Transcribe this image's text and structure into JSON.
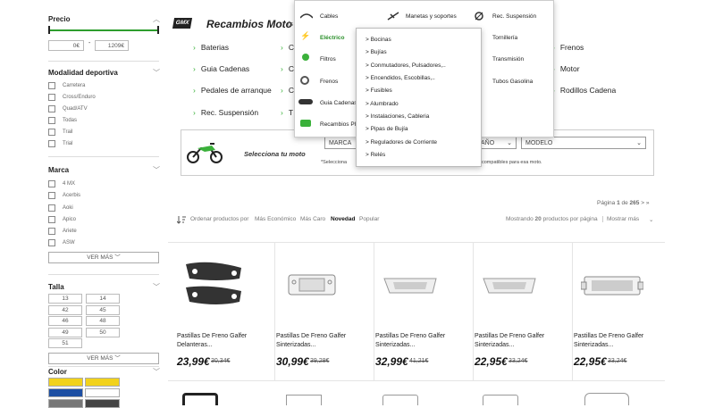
{
  "sidebar": {
    "price": {
      "title": "Precio",
      "min": "0€",
      "sep": "-",
      "max": "1209€"
    },
    "modalidad": {
      "title": "Modalidad deportiva",
      "items": [
        "Carretera",
        "Cross/Enduro",
        "Quad/ATV",
        "Todas",
        "Trail",
        "Trial"
      ]
    },
    "marca": {
      "title": "Marca",
      "items": [
        "4 MX",
        "Acerbis",
        "Aoki",
        "Apico",
        "Ariete",
        "ASW"
      ],
      "ver_mas": "VER MÁS"
    },
    "talla": {
      "title": "Talla",
      "sizes": [
        "13",
        "14",
        "42",
        "45",
        "46",
        "48",
        "49",
        "50",
        "51"
      ],
      "ver_mas": "VER MÁS"
    },
    "color": {
      "title": "Color",
      "swatches": [
        "#f2d21b",
        "#f2d21b",
        "#1d4fa3",
        "#ffffff",
        "#777777",
        "#444444"
      ]
    }
  },
  "brand_logo": "GMX",
  "header": {
    "title": "Recambios Moto",
    "subtitle": "(s"
  },
  "categories": {
    "col1": [
      "Baterias",
      "Guia Cadenas",
      "Pedales de arranque",
      "Rec. Suspensión"
    ],
    "col2": [
      "C",
      "C",
      "C",
      "T"
    ],
    "col4": [
      "Frenos",
      "Motor",
      "Rodillos Cadena"
    ]
  },
  "mega_menu": {
    "col1": [
      "Cables",
      "Eléctrico",
      "Filtros",
      "Frenos",
      "Guia Cadenas",
      "Recambios Pl"
    ],
    "col2": [
      "Manetas y soportes"
    ],
    "col3": [
      "Rec. Suspensión",
      "Tornillería",
      "Transmisión",
      "Tubos Gasolina"
    ]
  },
  "submenu": [
    "> Bocinas",
    "> Bujías",
    "> Conmutadores, Pulsadores,..",
    "> Encendidos, Escobillas,..",
    "> Fusibles",
    "> Alumbrado",
    "> Instalaciones, Cableria",
    "> Pipas de Bujía",
    "> Reguladores de Corriente",
    "> Relés"
  ],
  "selector": {
    "title": "Selecciona tu moto",
    "marca": "MARCA",
    "ano": "AÑO",
    "modelo": "MODELO",
    "note_start": "*Selecciona",
    "note_end": "compatibles para esa moto."
  },
  "pagination": {
    "prefix": "Página",
    "current": "1",
    "of": "de",
    "total": "265",
    "next": "> »"
  },
  "sort": {
    "label": "Ordenar productos por",
    "options": [
      "Más Económico",
      "Más Caro",
      "Novedad",
      "Popular"
    ],
    "active": "Novedad"
  },
  "per_page": {
    "prefix": "Mostrando",
    "count": "20",
    "suffix": "productos por página",
    "more": "Mostrar más"
  },
  "products": [
    {
      "name1": "Pastillas De Freno Galfer",
      "name2": "Delanteras...",
      "price": "23,99€",
      "old": "30,34€"
    },
    {
      "name1": "Pastillas De Freno Galfer",
      "name2": "Sinterizadas...",
      "price": "30,99€",
      "old": "39,28€"
    },
    {
      "name1": "Pastillas De Freno Galfer",
      "name2": "Sinterizadas...",
      "price": "32,99€",
      "old": "41,21€"
    },
    {
      "name1": "Pastillas De Freno Galfer",
      "name2": "Sinterizadas...",
      "price": "22,95€",
      "old": "33,24€"
    },
    {
      "name1": "Pastillas De Freno Galfer",
      "name2": "Sinterizadas...",
      "price": "22,95€",
      "old": "33,24€"
    }
  ]
}
